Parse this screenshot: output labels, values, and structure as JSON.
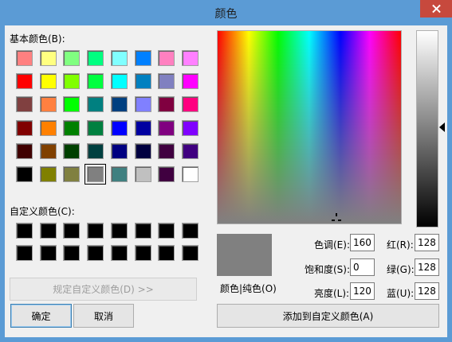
{
  "window": {
    "title": "颜色"
  },
  "basic": {
    "label": "基本颜色(B):",
    "colors": [
      "#ff8080",
      "#ffff80",
      "#80ff80",
      "#00ff80",
      "#80ffff",
      "#0080ff",
      "#ff80c0",
      "#ff80ff",
      "#ff0000",
      "#ffff00",
      "#80ff00",
      "#00ff40",
      "#00ffff",
      "#0080c0",
      "#8080c0",
      "#ff00ff",
      "#804040",
      "#ff8040",
      "#00ff00",
      "#008080",
      "#004080",
      "#8080ff",
      "#800040",
      "#ff0080",
      "#800000",
      "#ff8000",
      "#008000",
      "#008040",
      "#0000ff",
      "#0000a0",
      "#800080",
      "#8000ff",
      "#400000",
      "#804000",
      "#004000",
      "#004040",
      "#000080",
      "#000040",
      "#400040",
      "#400080",
      "#000000",
      "#808000",
      "#808040",
      "#808080",
      "#408080",
      "#c0c0c0",
      "#400040",
      "#ffffff"
    ]
  },
  "custom": {
    "label": "自定义颜色(C):"
  },
  "buttons": {
    "define_custom": "规定自定义颜色(D) >>",
    "ok": "确定",
    "cancel": "取消",
    "add_custom": "添加到自定义颜色(A)"
  },
  "preview": {
    "label": "颜色|纯色(O)"
  },
  "fields": {
    "hue": {
      "label": "色调(E):",
      "value": "160"
    },
    "sat": {
      "label": "饱和度(S):",
      "value": "0"
    },
    "lum": {
      "label": "亮度(L):",
      "value": "120"
    },
    "red": {
      "label": "红(R):",
      "value": "128"
    },
    "green": {
      "label": "绿(G):",
      "value": "128"
    },
    "blue": {
      "label": "蓝(U):",
      "value": "128"
    }
  }
}
